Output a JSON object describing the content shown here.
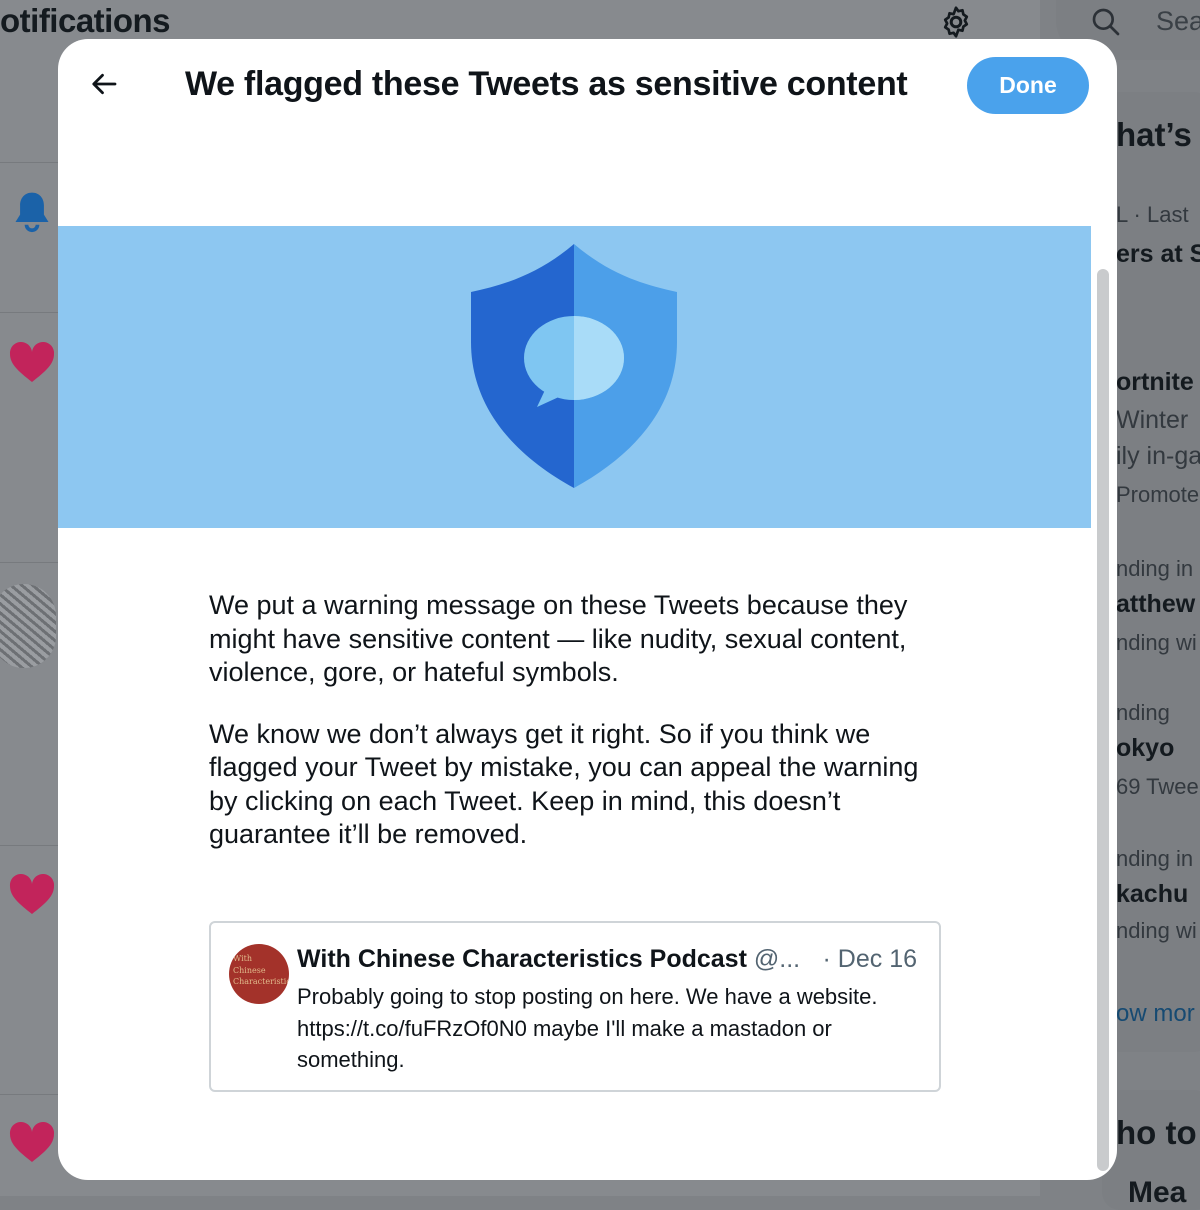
{
  "background": {
    "page_title": "otifications",
    "search_placeholder": "Sea",
    "trends": [
      {
        "text": "hat’s",
        "style": "big"
      },
      {
        "text": "L · Last",
        "style": "muted"
      },
      {
        "text": "ers at S",
        "style": "bold"
      },
      {
        "text": "ortnite",
        "style": "bold"
      },
      {
        "text": "Winter",
        "style": "muted"
      },
      {
        "text": "ily in-ga",
        "style": "muted"
      },
      {
        "text": "Promote",
        "style": "muted"
      },
      {
        "text": "nding in",
        "style": "muted"
      },
      {
        "text": "atthew",
        "style": "bold"
      },
      {
        "text": "nding wi",
        "style": "muted"
      },
      {
        "text": "nding",
        "style": "muted"
      },
      {
        "text": "okyo",
        "style": "bold"
      },
      {
        "text": "69 Twee",
        "style": "muted"
      },
      {
        "text": "nding in",
        "style": "muted"
      },
      {
        "text": "kachu",
        "style": "bold"
      },
      {
        "text": "nding wi",
        "style": "muted"
      },
      {
        "text": "ow mor",
        "style": "link"
      },
      {
        "text": "ho to",
        "style": "big"
      },
      {
        "text": "Mea",
        "style": "bold"
      }
    ]
  },
  "modal": {
    "title": "We flagged these Tweets as sensitive content",
    "done_label": "Done",
    "paragraphs": [
      "We put a warning message on these Tweets because they might have sensitive content — like nudity, sexual content, violence, gore, or hateful symbols.",
      "We know we don’t always get it right. So if you think we flagged your Tweet by mistake, you can appeal the warning by clicking on each Tweet. Keep in mind, this doesn’t guarantee it’ll be removed."
    ],
    "tweet": {
      "author": "With Chinese Characteristics Podcast",
      "handle": "@...",
      "date": "· Dec 16",
      "text": "Probably going to stop posting on here. We have a website. https://t.co/fuFRzOf0N0 maybe I'll make a mastadon or something.",
      "avatar_text": [
        "With",
        "Chinese",
        "Characteristics"
      ]
    }
  },
  "colors": {
    "accent": "#4aa2ec",
    "hero_bg": "#8dc7f1",
    "shield_dark": "#2466cf",
    "shield_light": "#4c9fe9",
    "heart": "#c2245b",
    "bell": "#1b62a8"
  }
}
